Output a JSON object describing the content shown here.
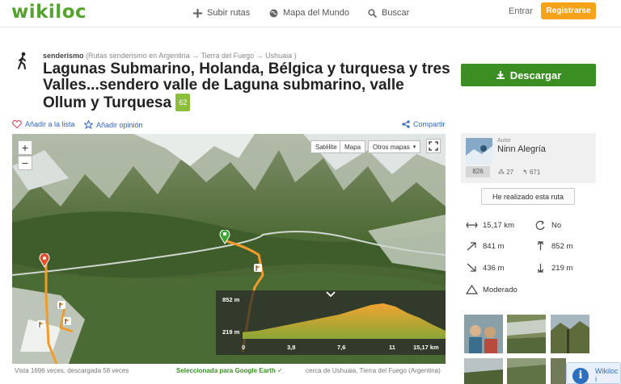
{
  "header": {
    "logo": "wikiloc",
    "nav": [
      {
        "label": "Subir rutas",
        "icon": "plus-icon"
      },
      {
        "label": "Mapa del Mundo",
        "icon": "globe-icon"
      },
      {
        "label": "Buscar",
        "icon": "search-icon"
      }
    ],
    "login": "Entrar",
    "register": "Registrarse"
  },
  "trail": {
    "activity": "senderismo",
    "breadcrumb": "(Rutas senderismo en Argentina → Tierra del Fuego → Ushuaia )",
    "title": "Lagunas Submarino, Holanda, Bélgica y turquesa y tres Valles...sendero valle de Laguna submarino, valle Ollum y Turquesa",
    "rank_badge": "62"
  },
  "actions": {
    "add_list": "Añadir a la lista",
    "add_review": "Añadir opinión",
    "share": "Compartir"
  },
  "download_button": "Descargar",
  "map": {
    "zoom_in": "+",
    "zoom_out": "−",
    "type_satellite": "Satélite",
    "type_map": "Mapa",
    "other_maps": "Otros mapas",
    "profile": {
      "y_max": "852 m",
      "y_min": "219 m",
      "x_ticks": [
        "0",
        "3,8",
        "7,6",
        "11",
        "15,17 km"
      ]
    }
  },
  "map_footer": {
    "views": "Vista 1696 veces, descargada 58 veces",
    "google_earth": "Seleccionada para Google Earth ✓",
    "location": "cerca de Ushuaia, Tierra del Fuego (Argentina)"
  },
  "author": {
    "label": "Autor",
    "name": "Ninn Alegría",
    "trails": "826",
    "followers": "27",
    "following": "671"
  },
  "done_button": "He realizado esta ruta",
  "stats": {
    "distance": "15,17 km",
    "loop": "No",
    "elev_gain": "841 m",
    "max_alt": "852 m",
    "elev_loss": "436 m",
    "min_alt": "219 m",
    "difficulty": "Moderado"
  },
  "info_popup": "Wikiloc i",
  "colors": {
    "brand_green": "#56a22f",
    "download_green": "#3a8e22",
    "register_orange": "#f7a21b",
    "link_blue": "#3468b6"
  }
}
